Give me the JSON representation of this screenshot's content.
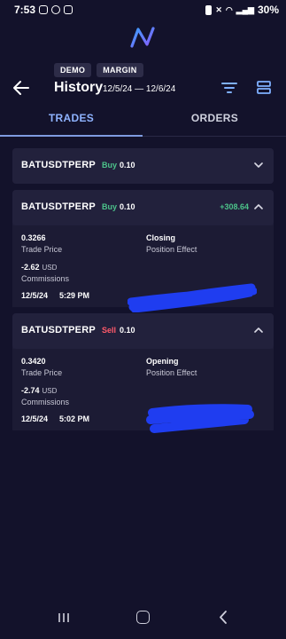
{
  "status_bar": {
    "time": "7:53",
    "battery": "30%"
  },
  "header": {
    "badges": [
      "DEMO",
      "MARGIN"
    ],
    "title": "History",
    "date_range": "12/5/24 — 12/6/24"
  },
  "tabs": [
    {
      "label": "TRADES",
      "active": true
    },
    {
      "label": "ORDERS",
      "active": false
    }
  ],
  "cards": [
    {
      "symbol": "BATUSDTPERP",
      "side": "Buy",
      "qty": "0.10",
      "expanded": false
    },
    {
      "symbol": "BATUSDTPERP",
      "side": "Buy",
      "qty": "0.10",
      "pnl": "+308.64",
      "expanded": true,
      "trade_price": "0.3266",
      "trade_price_label": "Trade Price",
      "commission": "-2.62",
      "commission_unit": "USD",
      "commission_label": "Commissions",
      "date": "12/5/24",
      "time": "5:29 PM",
      "position_effect": "Closing",
      "position_effect_label": "Position Effect"
    },
    {
      "symbol": "BATUSDTPERP",
      "side": "Sell",
      "qty": "0.10",
      "expanded": true,
      "trade_price": "0.3420",
      "trade_price_label": "Trade Price",
      "commission": "-2.74",
      "commission_unit": "USD",
      "commission_label": "Commissions",
      "date": "12/5/24",
      "time": "5:02 PM",
      "position_effect": "Opening",
      "position_effect_label": "Position Effect"
    }
  ],
  "colors": {
    "background": "#13122b",
    "buy": "#4cc38a",
    "sell": "#ff5a6a",
    "active_tab": "#8fb3ff",
    "redaction": "#1f3df0"
  },
  "icons": [
    "back-arrow-icon",
    "filter-icon",
    "layout-icon",
    "chevron-down-icon",
    "chevron-up-icon",
    "app-logo"
  ]
}
